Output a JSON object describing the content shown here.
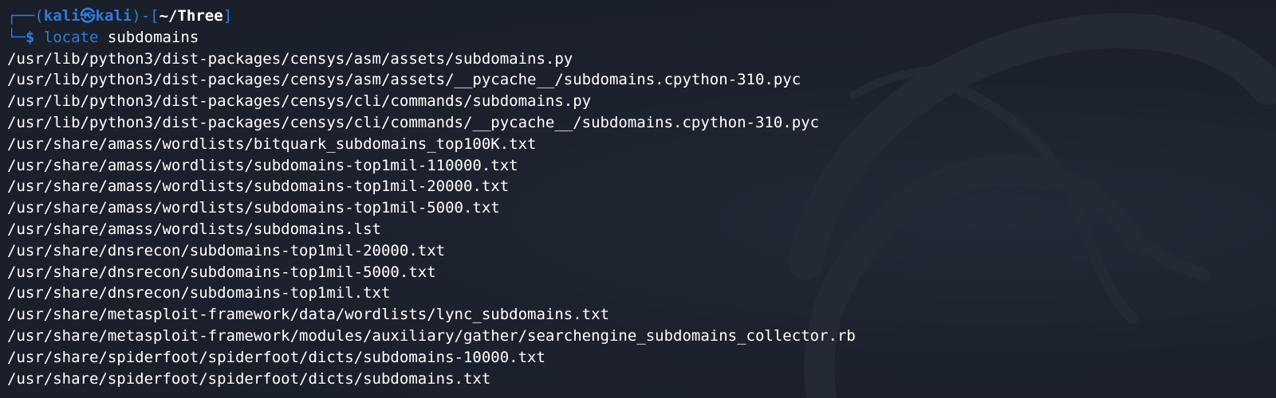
{
  "prompt": {
    "box_top_left": "┌──(",
    "user": "kali㉿kali",
    "mid": ")-[",
    "cwd": "~/Three",
    "box_close": "]",
    "box_bottom_left": "└─",
    "dollar": "$",
    "command": "locate",
    "argument": "subdomains"
  },
  "output": [
    "/usr/lib/python3/dist-packages/censys/asm/assets/subdomains.py",
    "/usr/lib/python3/dist-packages/censys/asm/assets/__pycache__/subdomains.cpython-310.pyc",
    "/usr/lib/python3/dist-packages/censys/cli/commands/subdomains.py",
    "/usr/lib/python3/dist-packages/censys/cli/commands/__pycache__/subdomains.cpython-310.pyc",
    "/usr/share/amass/wordlists/bitquark_subdomains_top100K.txt",
    "/usr/share/amass/wordlists/subdomains-top1mil-110000.txt",
    "/usr/share/amass/wordlists/subdomains-top1mil-20000.txt",
    "/usr/share/amass/wordlists/subdomains-top1mil-5000.txt",
    "/usr/share/amass/wordlists/subdomains.lst",
    "/usr/share/dnsrecon/subdomains-top1mil-20000.txt",
    "/usr/share/dnsrecon/subdomains-top1mil-5000.txt",
    "/usr/share/dnsrecon/subdomains-top1mil.txt",
    "/usr/share/metasploit-framework/data/wordlists/lync_subdomains.txt",
    "/usr/share/metasploit-framework/modules/auxiliary/gather/searchengine_subdomains_collector.rb",
    "/usr/share/spiderfoot/spiderfoot/dicts/subdomains-10000.txt",
    "/usr/share/spiderfoot/spiderfoot/dicts/subdomains.txt"
  ],
  "colors": {
    "background": "#1b212c",
    "prompt_blue": "#2f7be0",
    "text": "#ffffff"
  },
  "decoration": {
    "background_icon": "kali-dragon-icon"
  }
}
